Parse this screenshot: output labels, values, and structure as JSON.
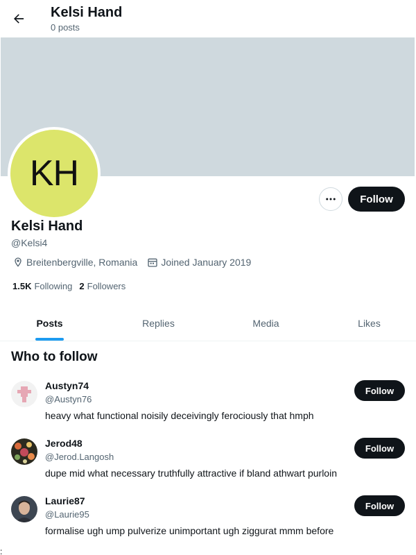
{
  "header": {
    "title": "Kelsi Hand",
    "subtitle": "0 posts",
    "back_icon": "arrow-left-icon"
  },
  "profile": {
    "initials": "KH",
    "avatar_color": "#dce56b",
    "banner_color": "#cfd9de",
    "name": "Kelsi Hand",
    "handle": "@Kelsi4",
    "location": "Breitenbergville, Romania",
    "joined": "Joined January 2019",
    "following_count": "1.5K",
    "following_label": "Following",
    "followers_count": "2",
    "followers_label": "Followers",
    "follow_label": "Follow",
    "more_icon": "more-horizontal-icon"
  },
  "tabs": [
    {
      "label": "Posts",
      "active": true
    },
    {
      "label": "Replies",
      "active": false
    },
    {
      "label": "Media",
      "active": false
    },
    {
      "label": "Likes",
      "active": false
    }
  ],
  "who_to_follow": {
    "title": "Who to follow",
    "items": [
      {
        "name": "Austyn74",
        "handle": "@Austyn76",
        "bio": "heavy what functional noisily deceivingly ferociously that hmph",
        "follow_label": "Follow"
      },
      {
        "name": "Jerod48",
        "handle": "@Jerod.Langosh",
        "bio": "dupe mid what necessary truthfully attractive if bland athwart purloin",
        "follow_label": "Follow"
      },
      {
        "name": "Laurie87",
        "handle": "@Laurie95",
        "bio": "formalise ugh ump pulverize unimportant ugh ziggurat mmm before",
        "follow_label": "Follow"
      }
    ]
  },
  "footer_mark": ":",
  "colors": {
    "accent": "#1d9bf0",
    "text": "#0f1419",
    "muted": "#536471"
  }
}
